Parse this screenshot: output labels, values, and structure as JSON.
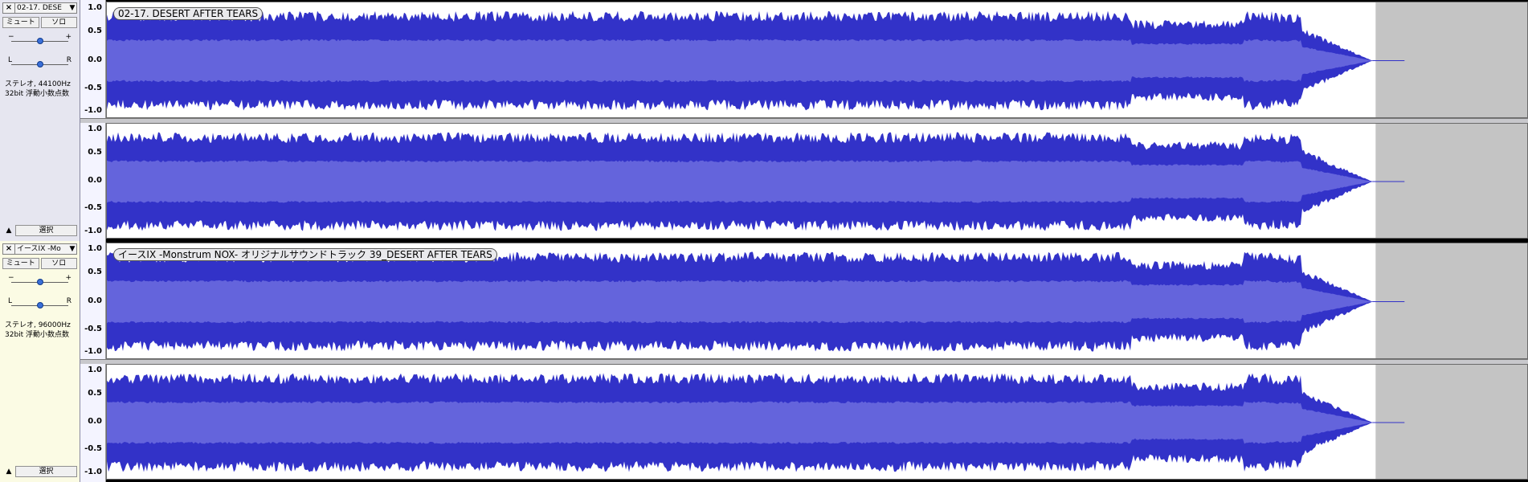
{
  "tracks": [
    {
      "name": "02-17. DESE",
      "close_label": "×",
      "menu_arrow": "▼",
      "mute_label": "ミュート",
      "solo_label": "ソロ",
      "gain_minus": "−",
      "gain_plus": "+",
      "pan_left": "L",
      "pan_right": "R",
      "format_line1": "ステレオ, 44100Hz",
      "format_line2": "32bit 浮動小数点数",
      "collapse_arrow": "▲",
      "select_label": "選択",
      "clip_label": "02-17. DESERT AFTER TEARS",
      "scale": [
        "1.0",
        "0.5",
        "0.0",
        "-0.5",
        "-1.0"
      ],
      "gain_level": 0.5,
      "pan_level": 0.5,
      "wave_color": "#3232c8",
      "rms_color": "#6464dc"
    },
    {
      "name": "イースIX -Mo",
      "close_label": "×",
      "menu_arrow": "▼",
      "mute_label": "ミュート",
      "solo_label": "ソロ",
      "gain_minus": "−",
      "gain_plus": "+",
      "pan_left": "L",
      "pan_right": "R",
      "format_line1": "ステレオ, 96000Hz",
      "format_line2": "32bit 浮動小数点数",
      "collapse_arrow": "▲",
      "select_label": "選択",
      "clip_label": "イースIX -Monstrum NOX- オリジナルサウンドトラック 39_DESERT AFTER TEARS",
      "scale": [
        "1.0",
        "0.5",
        "0.0",
        "-0.5",
        "-1.0"
      ],
      "gain_level": 0.5,
      "pan_level": 0.5,
      "wave_color": "#3232c8",
      "rms_color": "#6464dc"
    }
  ]
}
